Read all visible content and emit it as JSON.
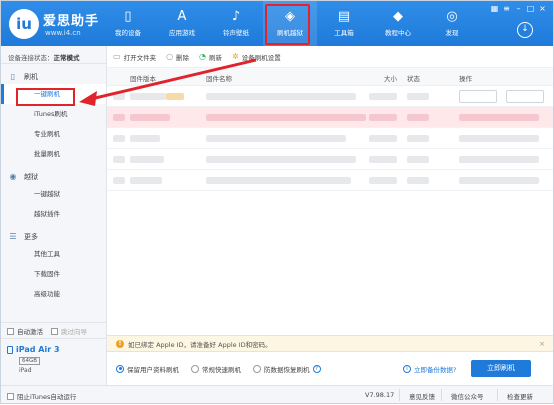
{
  "header": {
    "brand": "爱思助手",
    "site": "www.i4.cn",
    "logo_text": "iu",
    "nav": [
      {
        "label": "我的设备",
        "icon": "phone-icon"
      },
      {
        "label": "应用游戏",
        "icon": "app-store-icon"
      },
      {
        "label": "铃声壁纸",
        "icon": "music-wallpaper-icon"
      },
      {
        "label": "刷机越狱",
        "icon": "flash-jailbreak-icon"
      },
      {
        "label": "工具箱",
        "icon": "toolbox-icon"
      },
      {
        "label": "教程中心",
        "icon": "graduation-cap-icon"
      },
      {
        "label": "发现",
        "icon": "compass-icon"
      }
    ],
    "active_nav": "刷机越狱"
  },
  "sidebar": {
    "status_label": "设备连接状态：",
    "status_value": "正常模式",
    "groups": [
      {
        "label": "刷机",
        "icon": "flash-icon",
        "items": [
          "一键刷机",
          "iTunes刷机",
          "专业刷机",
          "批量刷机"
        ]
      },
      {
        "label": "越狱",
        "icon": "jailbreak-icon",
        "items": [
          "一键越狱",
          "越狱插件"
        ]
      },
      {
        "label": "更多",
        "icon": "menu-icon",
        "items": [
          "其他工具",
          "下载固件",
          "高级功能"
        ]
      }
    ],
    "active_item": "一键刷机",
    "auto_activate": "自动激活",
    "skip_guide": "跳过向导",
    "device_name": "iPad Air 3",
    "capacity": "64GB",
    "device_type": "iPad"
  },
  "toolbar": {
    "open_folder": "打开文件夹",
    "delete": "删除",
    "refresh": "刷新",
    "settings": "设备刷机设置"
  },
  "table": {
    "columns": [
      "固件版本",
      "固件名称",
      "大小",
      "状态",
      "操作"
    ]
  },
  "tip": {
    "text": "如已绑定 Apple ID，请准备好 Apple ID和密码。"
  },
  "options": {
    "radios": [
      "保留用户资料刷机",
      "常规快速刷机",
      "防数据恢复刷机"
    ],
    "selected": "保留用户资料刷机",
    "backup_link": "立即备份数据?",
    "flash_button": "立即刷机"
  },
  "statusbar": {
    "block_itunes": "阻止iTunes自动运行",
    "version": "V7.98.17",
    "feedback": "意见反馈",
    "wechat": "微信公众号",
    "check_update": "检查更新"
  },
  "colors": {
    "accent": "#1f7ad9",
    "highlight": "#e0242b"
  }
}
